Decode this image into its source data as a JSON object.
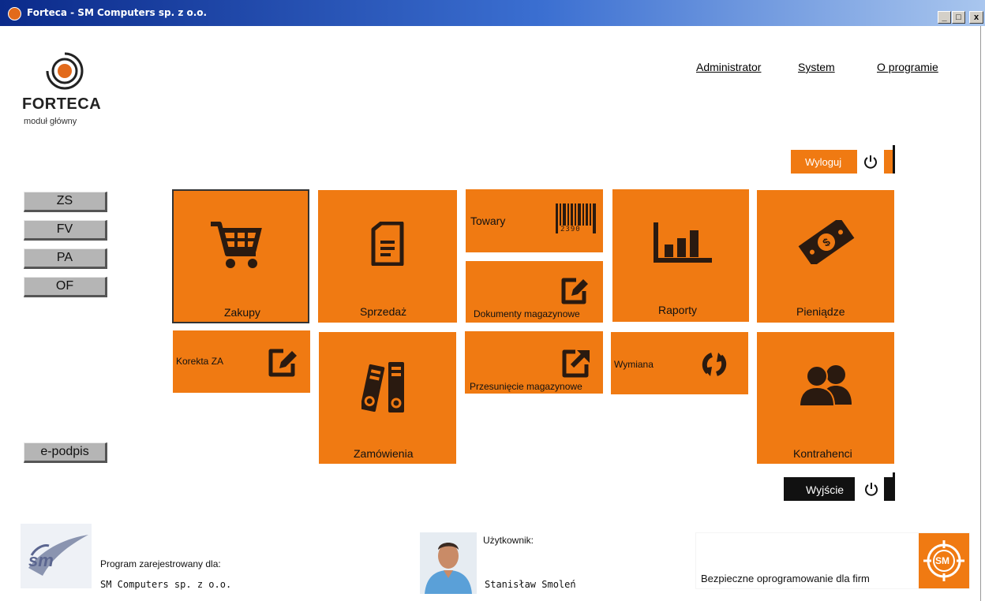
{
  "window": {
    "title": "Forteca - SM Computers sp. z o.o.",
    "minimize": "_",
    "maximize": "□",
    "close": "x"
  },
  "logo": {
    "name": "FORTECA",
    "subtitle": "moduł główny"
  },
  "nav": {
    "admin": "Administrator",
    "system": "System",
    "about": "O programie"
  },
  "actions": {
    "logout": "Wyloguj",
    "exit": "Wyjście"
  },
  "quick": {
    "zs": "ZS",
    "fv": "FV",
    "pa": "PA",
    "of": "OF",
    "epodpis": "e-podpis"
  },
  "tiles": {
    "zakupy": "Zakupy",
    "sprzedaz": "Sprzedaż",
    "towary": "Towary",
    "barcode_digits": "2390",
    "dokumenty": "Dokumenty magazynowe",
    "raporty": "Raporty",
    "pieniadze": "Pieniądze",
    "korekta": "Korekta ZA",
    "zamowienia": "Zamówienia",
    "przesuniecie": "Przesunięcie magazynowe",
    "wymiana": "Wymiana",
    "kontrahenci": "Kontrahenci"
  },
  "footer": {
    "registered_label": "Program zarejestrowany dla:",
    "registered_name": "SM Computers sp. z o.o.",
    "user_label": "Użytkownik:",
    "user_name": "Stanisław Smoleń",
    "slogan": "Bezpieczne oprogramowanie dla firm",
    "sm_badge": "SM",
    "sm_logo_text": "sm"
  },
  "colors": {
    "accent": "#f07a12",
    "dark_icon": "#2a1a10",
    "titlebar": "#0b2a8a"
  }
}
